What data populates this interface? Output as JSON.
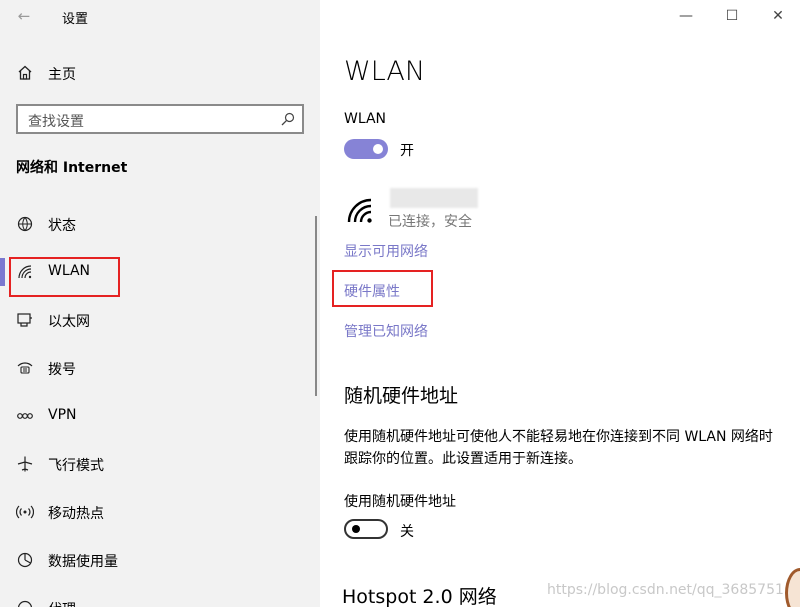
{
  "window": {
    "title": "设置",
    "controls": {
      "minimize": "—",
      "maximize": "☐",
      "close": "✕"
    }
  },
  "sidebar": {
    "back_icon": "back-arrow-icon",
    "home_label": "主页",
    "search_placeholder": "查找设置",
    "section_title": "网络和 Internet",
    "items": [
      {
        "label": "状态",
        "icon": "status-globe-icon",
        "active": false
      },
      {
        "label": "WLAN",
        "icon": "wifi-icon",
        "active": true
      },
      {
        "label": "以太网",
        "icon": "ethernet-icon",
        "active": false
      },
      {
        "label": "拨号",
        "icon": "dialup-icon",
        "active": false
      },
      {
        "label": "VPN",
        "icon": "vpn-icon",
        "active": false
      },
      {
        "label": "飞行模式",
        "icon": "airplane-icon",
        "active": false
      },
      {
        "label": "移动热点",
        "icon": "hotspot-icon",
        "active": false
      },
      {
        "label": "数据使用量",
        "icon": "data-usage-icon",
        "active": false
      },
      {
        "label": "代理",
        "icon": "globe-icon",
        "active": false
      }
    ],
    "accent_color": "#7a78d0"
  },
  "main": {
    "page_title": "WLAN",
    "wlan_toggle": {
      "label": "WLAN",
      "state_text": "开",
      "on": true
    },
    "network": {
      "status": "已连接，安全"
    },
    "links": {
      "show_available": "显示可用网络",
      "hardware_properties": "硬件属性",
      "manage_known": "管理已知网络"
    },
    "random_hw": {
      "heading": "随机硬件地址",
      "description": "使用随机硬件地址可使他人不能轻易地在你连接到不同 WLAN 网络时跟踪你的位置。此设置适用于新连接。",
      "toggle_label": "使用随机硬件地址",
      "state_text": "关",
      "on": false
    },
    "hotspot_heading": "Hotspot 2.0 网络",
    "link_color": "#7a78c8",
    "highlight_color": "#e52222"
  },
  "watermark": "https://blog.csdn.net/qq_3685751"
}
